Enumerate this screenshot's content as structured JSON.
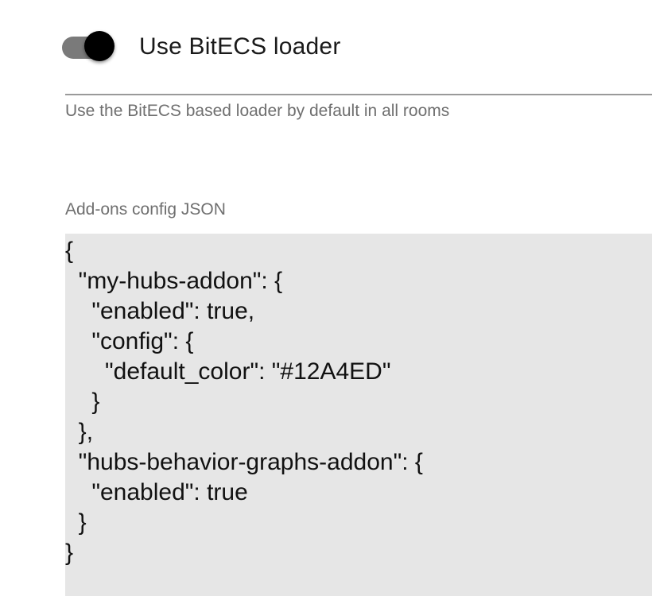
{
  "toggle": {
    "label": "Use BitECS loader",
    "checked": true,
    "description": "Use the BitECS based loader by default in all rooms",
    "track_color": "#7a7a7a",
    "knob_color": "#000000"
  },
  "addons_config": {
    "label": "Add-ons config JSON",
    "lines": [
      "{",
      "  \"my-hubs-addon\": {",
      "    \"enabled\": true,",
      "    \"config\": {",
      "      \"default_color\": \"#12A4ED\"",
      "    }",
      "  },",
      "  \"hubs-behavior-graphs-addon\": {",
      "    \"enabled\": true",
      "  }",
      "}"
    ],
    "background_color": "#e6e6e6"
  }
}
